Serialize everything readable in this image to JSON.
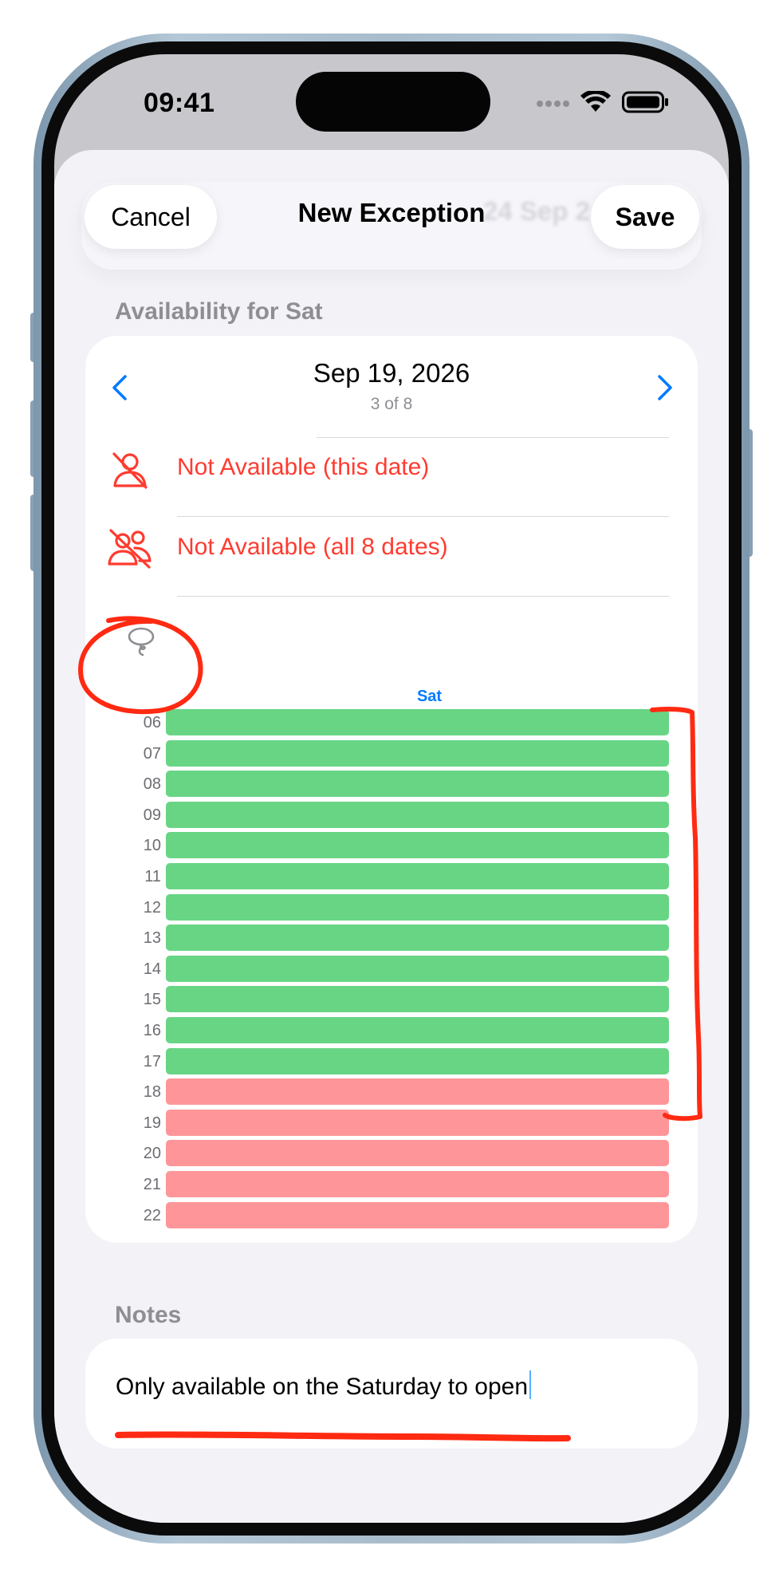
{
  "status_bar": {
    "time": "09:41"
  },
  "nav": {
    "cancel_label": "Cancel",
    "title": "New Exception",
    "save_label": "Save",
    "background_text": "24 Sep 2"
  },
  "availability": {
    "section_header": "Availability for Sat",
    "date_title": "Sep 19, 2026",
    "date_position": "3 of 8",
    "not_available_this_date": "Not Available (this date)",
    "not_available_all_dates": "Not Available (all 8 dates)",
    "day_label": "Sat",
    "slots": [
      {
        "hour": "06",
        "status": "available"
      },
      {
        "hour": "07",
        "status": "available"
      },
      {
        "hour": "08",
        "status": "available"
      },
      {
        "hour": "09",
        "status": "available"
      },
      {
        "hour": "10",
        "status": "available"
      },
      {
        "hour": "11",
        "status": "available"
      },
      {
        "hour": "12",
        "status": "available"
      },
      {
        "hour": "13",
        "status": "available"
      },
      {
        "hour": "14",
        "status": "available"
      },
      {
        "hour": "15",
        "status": "available"
      },
      {
        "hour": "16",
        "status": "available"
      },
      {
        "hour": "17",
        "status": "available"
      },
      {
        "hour": "18",
        "status": "unavailable"
      },
      {
        "hour": "19",
        "status": "unavailable"
      },
      {
        "hour": "20",
        "status": "unavailable"
      },
      {
        "hour": "21",
        "status": "unavailable"
      },
      {
        "hour": "22",
        "status": "unavailable"
      }
    ]
  },
  "notes": {
    "section_header": "Notes",
    "value": "Only available on the Saturday to open"
  },
  "icons": {
    "prev": "chevron-left-icon",
    "next": "chevron-right-icon",
    "this_date": "person-slash-icon",
    "all_dates": "people-slash-icon",
    "lasso": "lasso-icon"
  },
  "colors": {
    "accent": "#007aff",
    "destructive": "#ff3b30",
    "available": "#68d585",
    "unavailable": "#fe9699",
    "annotation": "#ff2a12"
  }
}
